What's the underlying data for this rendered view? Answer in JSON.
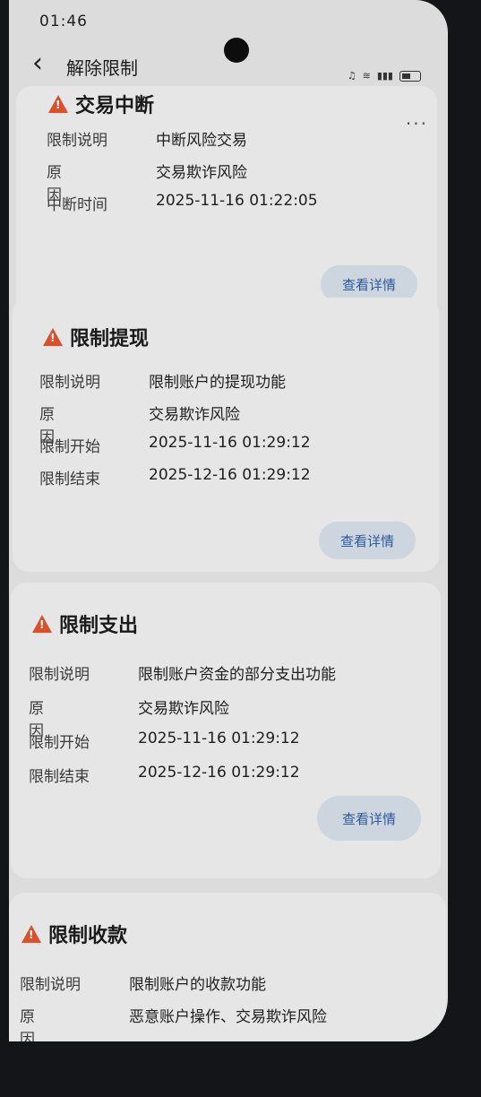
{
  "status_bar": {
    "time": "01:46"
  },
  "nav": {
    "title": "解除限制"
  },
  "cards": [
    {
      "title": "交易中断",
      "rows": [
        {
          "label": "限制说明",
          "value": "中断风险交易"
        },
        {
          "label": "原因",
          "value": "交易欺诈风险"
        },
        {
          "label": "中断时间",
          "value": "2025-11-16 01:22:05"
        }
      ],
      "button": "查看详情"
    },
    {
      "title": "限制提现",
      "rows": [
        {
          "label": "限制说明",
          "value": "限制账户的提现功能"
        },
        {
          "label": "原因",
          "value": "交易欺诈风险"
        },
        {
          "label": "限制开始",
          "value": "2025-11-16 01:29:12"
        },
        {
          "label": "限制结束",
          "value": "2025-12-16 01:29:12"
        }
      ],
      "button": "查看详情"
    },
    {
      "title": "限制支出",
      "rows": [
        {
          "label": "限制说明",
          "value": "限制账户资金的部分支出功能"
        },
        {
          "label": "原因",
          "value": "交易欺诈风险"
        },
        {
          "label": "限制开始",
          "value": "2025-11-16 01:29:12"
        },
        {
          "label": "限制结束",
          "value": "2025-12-16 01:29:12"
        }
      ],
      "button": "查看详情"
    },
    {
      "title": "限制收款",
      "rows": [
        {
          "label": "限制说明",
          "value": "限制账户的收款功能"
        },
        {
          "label": "原因",
          "value": "恶意账户操作、交易欺诈风险"
        }
      ]
    }
  ]
}
